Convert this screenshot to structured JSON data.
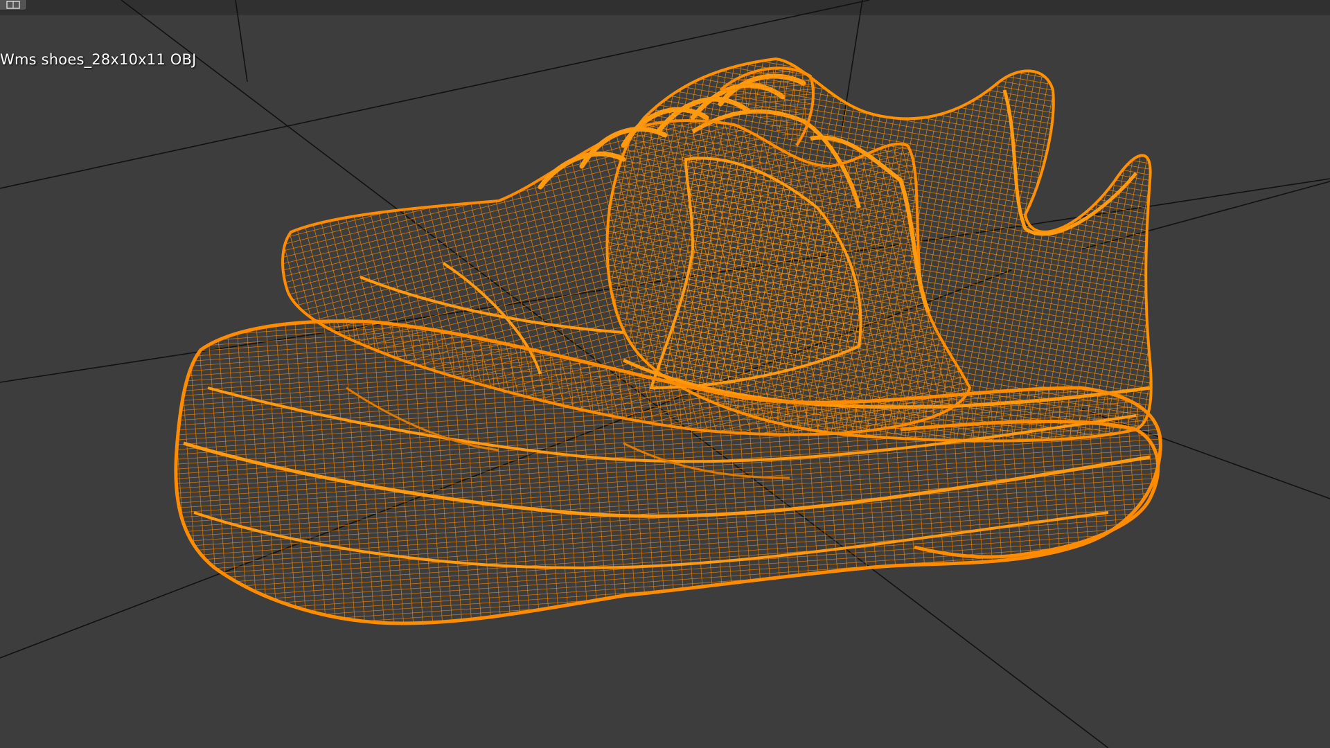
{
  "viewport": {
    "object_label": "Wms shoes_28x10x11 OBJ",
    "background_color": "#3d3d3d",
    "grid_line_color": "#111111",
    "wireframe_color": "#ff8c00",
    "wireframe_dark_color": "#d86f00"
  },
  "header": {
    "view_toggle_icon": "viewport-view-icon"
  }
}
